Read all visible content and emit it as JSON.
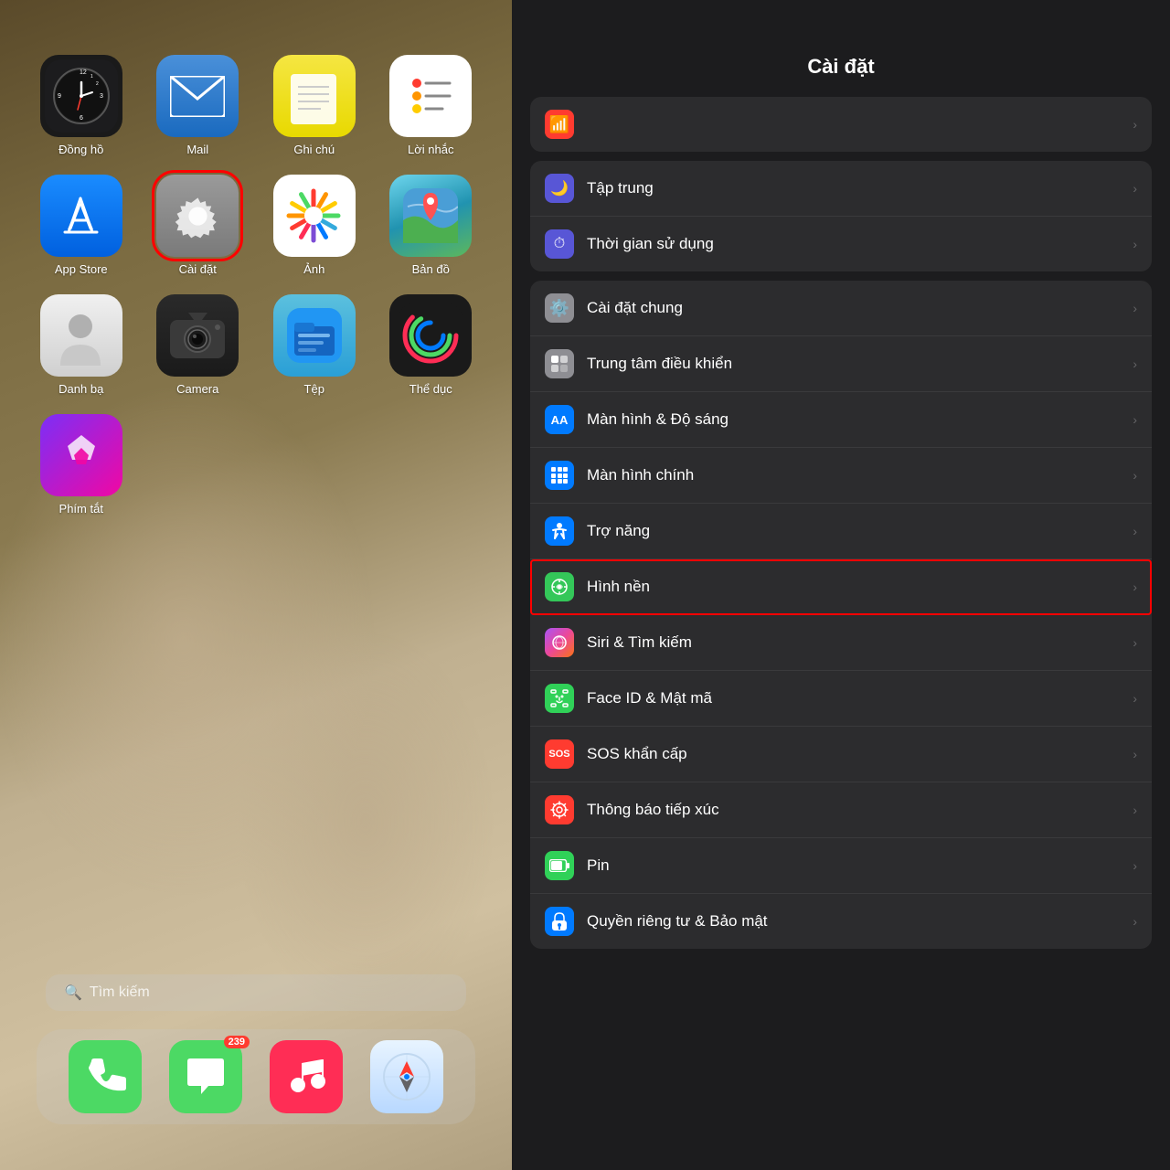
{
  "left": {
    "apps_row1": [
      {
        "id": "clock",
        "label": "Đồng hồ",
        "highlighted": false
      },
      {
        "id": "mail",
        "label": "Mail",
        "highlighted": false
      },
      {
        "id": "notes",
        "label": "Ghi chú",
        "highlighted": false
      },
      {
        "id": "reminders",
        "label": "Lời nhắc",
        "highlighted": false
      }
    ],
    "apps_row2": [
      {
        "id": "appstore",
        "label": "App Store",
        "highlighted": false
      },
      {
        "id": "settings",
        "label": "Cài đặt",
        "highlighted": true
      },
      {
        "id": "photos",
        "label": "Ảnh",
        "highlighted": false
      },
      {
        "id": "maps",
        "label": "Bản đồ",
        "highlighted": false
      }
    ],
    "apps_row3": [
      {
        "id": "contacts",
        "label": "Danh bạ",
        "highlighted": false
      },
      {
        "id": "camera",
        "label": "Camera",
        "highlighted": false
      },
      {
        "id": "files",
        "label": "Tệp",
        "highlighted": false
      },
      {
        "id": "fitness",
        "label": "Thể dục",
        "highlighted": false
      }
    ],
    "apps_row4": [
      {
        "id": "shortcuts",
        "label": "Phím tắt",
        "highlighted": false
      }
    ],
    "search_placeholder": "Tìm kiếm",
    "dock": [
      {
        "id": "phone",
        "label": "Phone",
        "badge": null
      },
      {
        "id": "messages",
        "label": "Messages",
        "badge": "239"
      },
      {
        "id": "music",
        "label": "Music",
        "badge": null
      },
      {
        "id": "safari",
        "label": "Safari",
        "badge": null
      }
    ]
  },
  "right": {
    "title": "Cài đặt",
    "sections": [
      {
        "id": "top-partial",
        "rows": [
          {
            "id": "top-partial",
            "icon_color": "#ff3b30",
            "icon_type": "partial",
            "label": "",
            "chevron": true
          }
        ]
      },
      {
        "id": "notifications-group",
        "rows": [
          {
            "id": "focus",
            "icon_color": "#5856d6",
            "icon_char": "🌙",
            "label": "Tập trung",
            "chevron": true
          },
          {
            "id": "screentime",
            "icon_color": "#5856d6",
            "icon_char": "⏱",
            "label": "Thời gian sử dụng",
            "chevron": true
          }
        ]
      },
      {
        "id": "general-group",
        "rows": [
          {
            "id": "general",
            "icon_color": "#8e8e93",
            "icon_char": "⚙",
            "label": "Cài đặt chung",
            "chevron": true
          },
          {
            "id": "controlcenter",
            "icon_color": "#8e8e93",
            "icon_char": "▣",
            "label": "Trung tâm điều khiển",
            "chevron": true
          },
          {
            "id": "display",
            "icon_color": "#007aff",
            "icon_char": "AA",
            "label": "Màn hình & Độ sáng",
            "chevron": true
          },
          {
            "id": "homescreen",
            "icon_color": "#007aff",
            "icon_char": "⊞",
            "label": "Màn hình chính",
            "chevron": true
          },
          {
            "id": "accessibility",
            "icon_color": "#007aff",
            "icon_char": "♿",
            "label": "Trợ năng",
            "chevron": true
          },
          {
            "id": "wallpaper",
            "icon_color": "#34c759",
            "icon_char": "❋",
            "label": "Hình nền",
            "chevron": true,
            "highlighted": true
          },
          {
            "id": "siri",
            "icon_color": "gradient",
            "icon_char": "◎",
            "label": "Siri & Tìm kiếm",
            "chevron": true
          },
          {
            "id": "faceid",
            "icon_color": "#30d158",
            "icon_char": "😊",
            "label": "Face ID & Mật mã",
            "chevron": true
          },
          {
            "id": "sos",
            "icon_color": "#ff3b30",
            "icon_char": "SOS",
            "label": "SOS khẩn cấp",
            "chevron": true
          },
          {
            "id": "exposure",
            "icon_color": "#ff3b30",
            "icon_char": "⊙",
            "label": "Thông báo tiếp xúc",
            "chevron": true
          },
          {
            "id": "battery",
            "icon_color": "#30d158",
            "icon_char": "▮",
            "label": "Pin",
            "chevron": true
          },
          {
            "id": "privacy",
            "icon_color": "#007aff",
            "icon_char": "🤚",
            "label": "Quyền riêng tư & Bảo mật",
            "chevron": true
          }
        ]
      }
    ]
  }
}
